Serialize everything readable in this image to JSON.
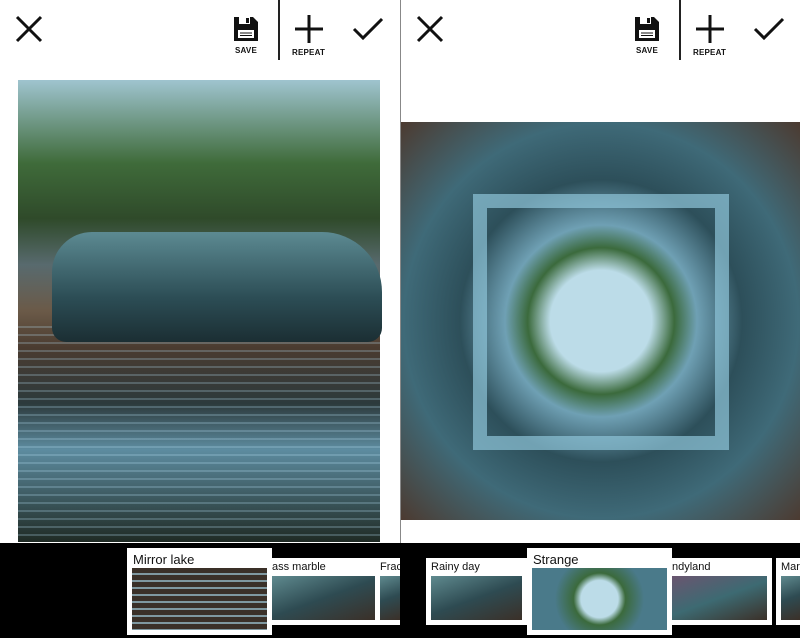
{
  "panels": [
    {
      "toolbar": {
        "close_icon": "close-icon",
        "save_label": "SAVE",
        "repeat_label": "REPEAT",
        "apply_icon": "check-icon"
      },
      "effect": "Mirror lake"
    },
    {
      "toolbar": {
        "close_icon": "close-icon",
        "save_label": "SAVE",
        "repeat_label": "REPEAT",
        "apply_icon": "check-icon"
      },
      "effect": "Strange"
    }
  ],
  "effects_strip": [
    "Mirror lake",
    "ass marble",
    "Frac",
    "Rainy day",
    "Strange",
    "ndyland",
    "Marb"
  ],
  "colors": {
    "toolbar_bg": "#ffffff",
    "strip_bg": "#000000",
    "icon": "#111111"
  }
}
